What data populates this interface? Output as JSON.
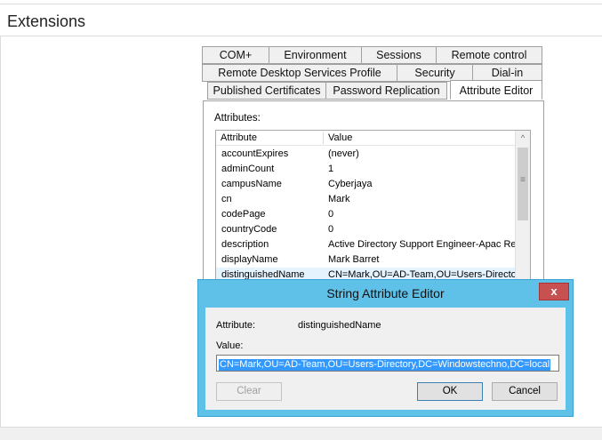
{
  "page": {
    "section_title": "Extensions"
  },
  "tabs": {
    "row1": [
      "COM+",
      "Environment",
      "Sessions",
      "Remote control"
    ],
    "row2": [
      "Remote Desktop Services Profile",
      "Security",
      "Dial-in"
    ],
    "row3": [
      "Published Certificates",
      "Password Replication",
      "Attribute Editor"
    ]
  },
  "attribute_editor": {
    "label": "Attributes:",
    "columns": [
      "Attribute",
      "Value"
    ],
    "rows": [
      {
        "attr": "accountExpires",
        "value": "(never)"
      },
      {
        "attr": "adminCount",
        "value": "1"
      },
      {
        "attr": "campusName",
        "value": "Cyberjaya"
      },
      {
        "attr": "cn",
        "value": "Mark"
      },
      {
        "attr": "codePage",
        "value": "0"
      },
      {
        "attr": "countryCode",
        "value": "0"
      },
      {
        "attr": "description",
        "value": "Active Directory Support Engineer-Apac Reg"
      },
      {
        "attr": "displayName",
        "value": "Mark Barret"
      },
      {
        "attr": "distinguishedName",
        "value": "CN=Mark,OU=AD-Team,OU=Users-Directory"
      }
    ],
    "scroll_up_glyph": "^",
    "scroll_grip_glyph": "≡"
  },
  "string_editor": {
    "title": "String Attribute Editor",
    "close_glyph": "x",
    "attribute_label": "Attribute:",
    "attribute_value": "distinguishedName",
    "value_label": "Value:",
    "value": "CN=Mark,OU=AD-Team,OU=Users-Directory,DC=Windowstechno,DC=local",
    "clear_label": "Clear",
    "ok_label": "OK",
    "cancel_label": "Cancel"
  },
  "colors": {
    "title_bar": "#5fc1e8",
    "close_button": "#c75050",
    "selection": "#3399ff"
  }
}
